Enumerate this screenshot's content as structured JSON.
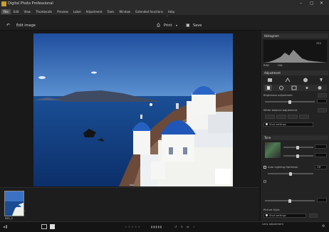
{
  "app": {
    "title": "Digital Photo Professional"
  },
  "menu": {
    "items": [
      "File",
      "Edit",
      "View",
      "Thumbnails",
      "Preview",
      "Label",
      "Adjustment",
      "Tools",
      "Window",
      "Extended functions",
      "Help"
    ]
  },
  "toolbar": {
    "edit_image_label": "Edit image",
    "print_label": "Print",
    "save_label": "Save"
  },
  "filmstrip": {
    "thumb_label": "IMG_0"
  },
  "panel": {
    "histogram_header": "Histogram",
    "histogram_value": "255",
    "channel_rgb": "RGB",
    "channel_hsl": "HSL",
    "adjust_header": "Adjustment",
    "brightness_label": "Brightness adjustment",
    "wb_label": "White balance adjustment",
    "shot_settings": "Shot settings",
    "tone_header": "Tone",
    "auto_lighting_label": "Auto Lighting Optimizer",
    "auto_lighting_value": "Off",
    "picture_style_label": "Picture Style",
    "picture_style_value": "Shot settings",
    "lens_label": "Lens adjustment"
  },
  "colors": {
    "accent": "#3a78c8",
    "panel_bg": "#232323",
    "app_bg": "#1b1b1b"
  }
}
